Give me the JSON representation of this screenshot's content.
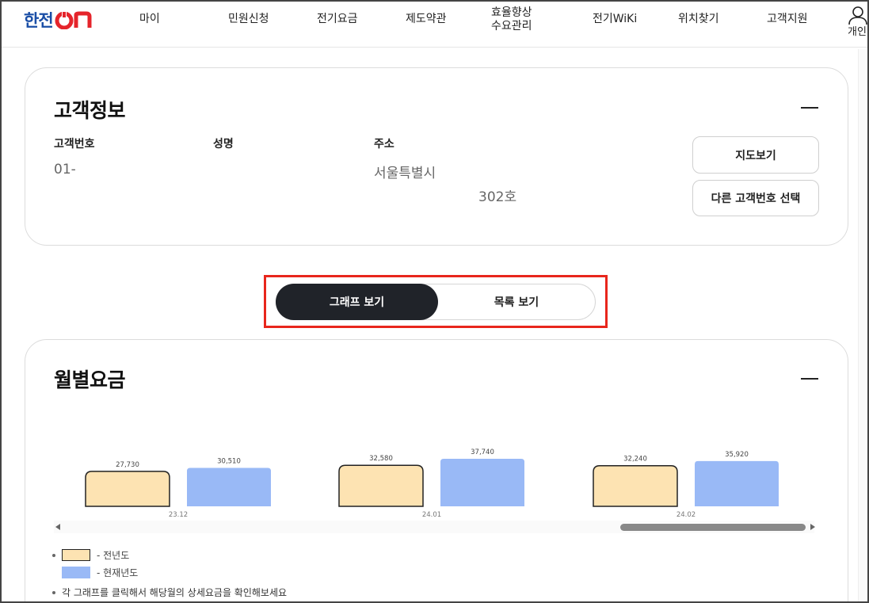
{
  "header": {
    "logo_main": "한전",
    "logo_on": "ON",
    "nav": [
      {
        "label": "마이"
      },
      {
        "label": "민원신청"
      },
      {
        "label": "전기요금"
      },
      {
        "label": "제도약관"
      },
      {
        "label": "효율향상\n수요관리"
      },
      {
        "label": "전기WiKi"
      },
      {
        "label": "위치찾기"
      },
      {
        "label": "고객지원"
      }
    ],
    "user_label": "개인"
  },
  "customer": {
    "title": "고객정보",
    "number_label": "고객번호",
    "number_value": "01-",
    "name_label": "성명",
    "name_value": "",
    "address_label": "주소",
    "address_line1": "서울특별시",
    "address_line2": "302호",
    "map_button": "지도보기",
    "select_button": "다른 고객번호 선택"
  },
  "view_toggle": {
    "graph_label": "그래프 보기",
    "list_label": "목록 보기",
    "active": "graph"
  },
  "monthly": {
    "title": "월별요금",
    "legend_prev": "- 전년도",
    "legend_curr": "- 현재년도",
    "note": "각 그래프를 클릭해서 해당월의 상세요금을 확인해보세요"
  },
  "colors": {
    "prev_year": "#fde3b2",
    "curr_year": "#99b9f6",
    "accent_dark": "#202329",
    "highlight_outline": "#e8261c"
  },
  "chart_data": {
    "type": "bar",
    "categories": [
      "23.12",
      "24.01",
      "24.02"
    ],
    "series": [
      {
        "name": "전년도",
        "values": [
          27730,
          32580,
          32240
        ],
        "labels": [
          "27,730",
          "32,580",
          "32,240"
        ]
      },
      {
        "name": "현재년도",
        "values": [
          30510,
          37740,
          35920
        ],
        "labels": [
          "30,510",
          "37,740",
          "35,920"
        ]
      }
    ]
  }
}
